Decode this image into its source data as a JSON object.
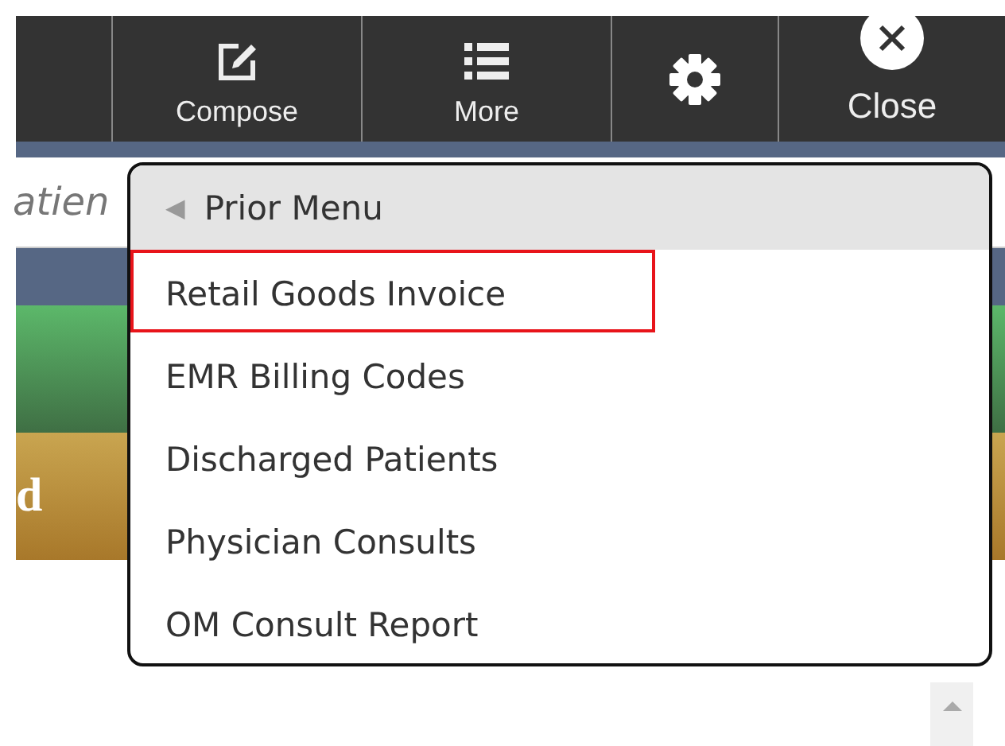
{
  "toolbar": {
    "buttons": [
      {
        "kind": "compose",
        "label": "Compose"
      },
      {
        "kind": "more",
        "label": "More"
      },
      {
        "kind": "settings"
      },
      {
        "kind": "close",
        "label": "Close"
      }
    ]
  },
  "page": {
    "search_text": "atien",
    "banner_text": "d"
  },
  "menu": {
    "back": {
      "arrow": "◀",
      "label": "Prior Menu"
    },
    "items": [
      {
        "label": "Retail Goods Invoice",
        "selected": true
      },
      {
        "label": "EMR Billing Codes",
        "selected": false
      },
      {
        "label": "Discharged Patients",
        "selected": false
      },
      {
        "label": "Physician Consults",
        "selected": false
      },
      {
        "label": "OM Consult Report",
        "selected": false
      }
    ]
  }
}
